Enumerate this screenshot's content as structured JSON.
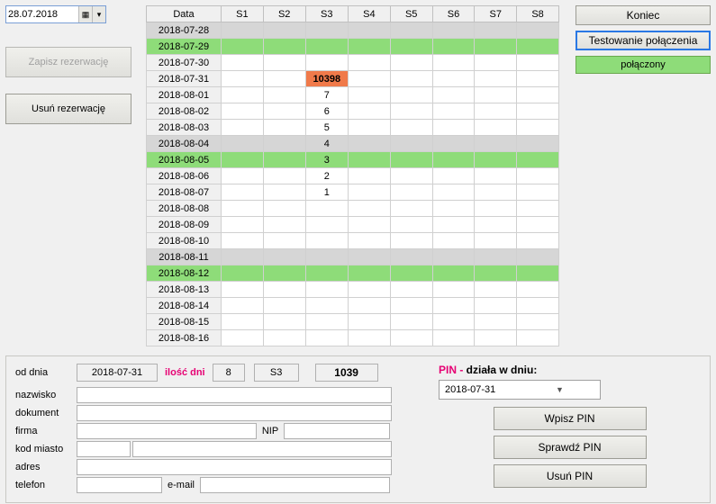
{
  "date_picker": {
    "value": "28.07.2018"
  },
  "buttons": {
    "save": "Zapisz rezerwację",
    "delete": "Usuń rezerwację",
    "close": "Koniec",
    "test_conn": "Testowanie połączenia",
    "status": "połączony"
  },
  "grid": {
    "headers": [
      "Data",
      "S1",
      "S2",
      "S3",
      "S4",
      "S5",
      "S6",
      "S7",
      "S8"
    ],
    "rows": [
      {
        "date": "2018-07-28",
        "cls": "grey",
        "cells": [
          "",
          "",
          "",
          "",
          "",
          "",
          "",
          ""
        ]
      },
      {
        "date": "2018-07-29",
        "cls": "green",
        "cells": [
          "",
          "",
          "",
          "",
          "",
          "",
          "",
          ""
        ]
      },
      {
        "date": "2018-07-30",
        "cls": "",
        "cells": [
          "",
          "",
          "",
          "",
          "",
          "",
          "",
          ""
        ]
      },
      {
        "date": "2018-07-31",
        "cls": "",
        "cells": [
          "",
          "",
          "10398",
          "",
          "",
          "",
          "",
          ""
        ],
        "hl": 2
      },
      {
        "date": "2018-08-01",
        "cls": "",
        "cells": [
          "",
          "",
          "7",
          "",
          "",
          "",
          "",
          ""
        ]
      },
      {
        "date": "2018-08-02",
        "cls": "",
        "cells": [
          "",
          "",
          "6",
          "",
          "",
          "",
          "",
          ""
        ]
      },
      {
        "date": "2018-08-03",
        "cls": "",
        "cells": [
          "",
          "",
          "5",
          "",
          "",
          "",
          "",
          ""
        ]
      },
      {
        "date": "2018-08-04",
        "cls": "grey",
        "cells": [
          "",
          "",
          "4",
          "",
          "",
          "",
          "",
          ""
        ]
      },
      {
        "date": "2018-08-05",
        "cls": "green",
        "cells": [
          "",
          "",
          "3",
          "",
          "",
          "",
          "",
          ""
        ]
      },
      {
        "date": "2018-08-06",
        "cls": "",
        "cells": [
          "",
          "",
          "2",
          "",
          "",
          "",
          "",
          ""
        ]
      },
      {
        "date": "2018-08-07",
        "cls": "",
        "cells": [
          "",
          "",
          "1",
          "",
          "",
          "",
          "",
          ""
        ]
      },
      {
        "date": "2018-08-08",
        "cls": "",
        "cells": [
          "",
          "",
          "",
          "",
          "",
          "",
          "",
          ""
        ]
      },
      {
        "date": "2018-08-09",
        "cls": "",
        "cells": [
          "",
          "",
          "",
          "",
          "",
          "",
          "",
          ""
        ]
      },
      {
        "date": "2018-08-10",
        "cls": "",
        "cells": [
          "",
          "",
          "",
          "",
          "",
          "",
          "",
          ""
        ]
      },
      {
        "date": "2018-08-11",
        "cls": "grey",
        "cells": [
          "",
          "",
          "",
          "",
          "",
          "",
          "",
          ""
        ]
      },
      {
        "date": "2018-08-12",
        "cls": "green",
        "cells": [
          "",
          "",
          "",
          "",
          "",
          "",
          "",
          ""
        ]
      },
      {
        "date": "2018-08-13",
        "cls": "",
        "cells": [
          "",
          "",
          "",
          "",
          "",
          "",
          "",
          ""
        ]
      },
      {
        "date": "2018-08-14",
        "cls": "",
        "cells": [
          "",
          "",
          "",
          "",
          "",
          "",
          "",
          ""
        ]
      },
      {
        "date": "2018-08-15",
        "cls": "",
        "cells": [
          "",
          "",
          "",
          "",
          "",
          "",
          "",
          ""
        ]
      },
      {
        "date": "2018-08-16",
        "cls": "",
        "cells": [
          "",
          "",
          "",
          "",
          "",
          "",
          "",
          ""
        ]
      }
    ]
  },
  "form": {
    "labels": {
      "od_dnia": "od dnia",
      "nazwisko": "nazwisko",
      "dokument": "dokument",
      "firma": "firma",
      "kod_miasto": "kod miasto",
      "adres": "adres",
      "telefon": "telefon",
      "email": "e-mail",
      "nip": "NIP",
      "ilosc_dni": "ilość dni"
    },
    "od_dnia": "2018-07-31",
    "ilosc_dni": "8",
    "slot": "S3",
    "pin_big": "1039"
  },
  "pin": {
    "header_a": "PIN  -  ",
    "header_b": "działa w dniu:",
    "date": "2018-07-31",
    "btn_enter": "Wpisz PIN",
    "btn_check": "Sprawdź PIN",
    "btn_del": "Usuń PIN"
  }
}
